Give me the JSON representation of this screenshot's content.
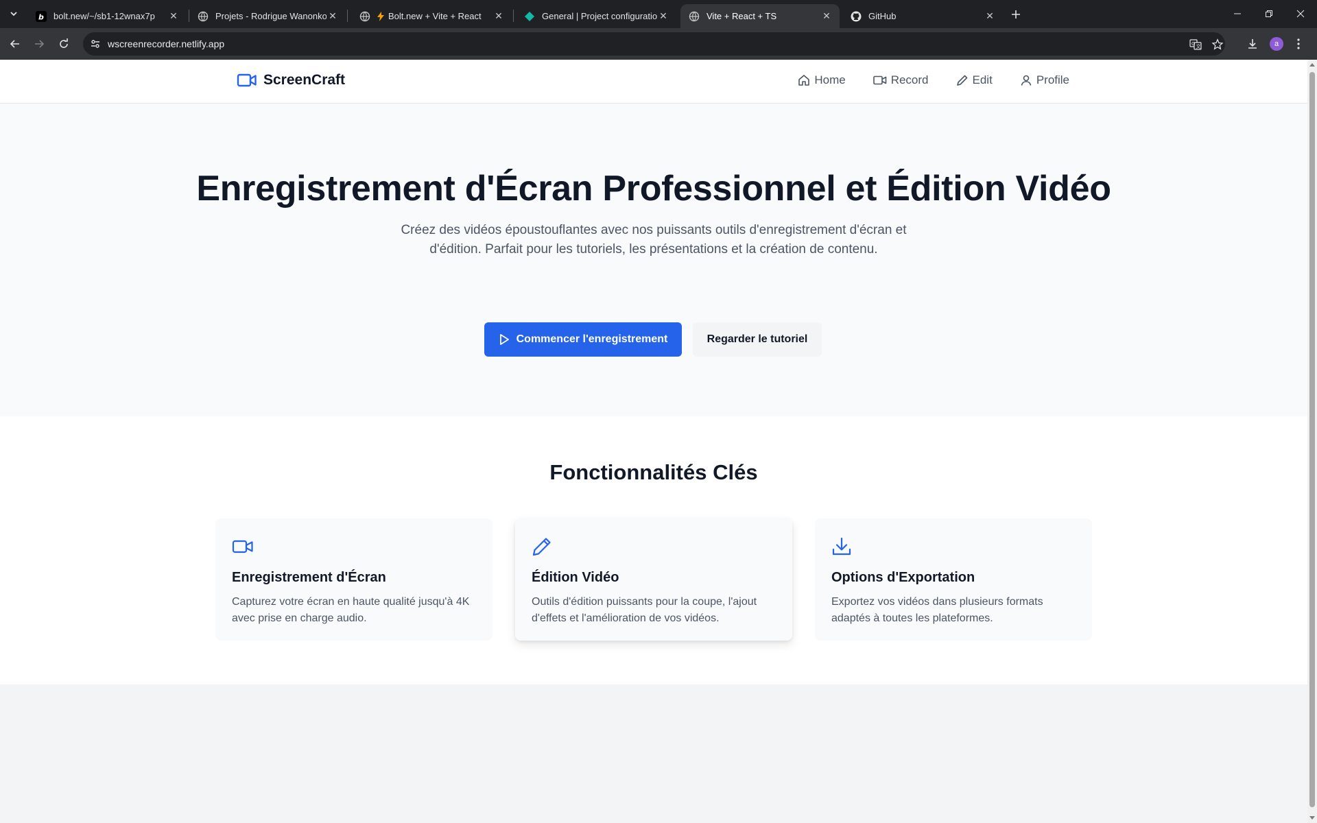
{
  "browser": {
    "tabs": [
      {
        "title": "bolt.new/~/sb1-12wnax7p",
        "icon": "bolt-b-icon"
      },
      {
        "title": "Projets - Rodrigue Wanonkou",
        "icon": "globe-icon"
      },
      {
        "title": "Bolt.new + Vite + React",
        "icon": "globe-icon"
      },
      {
        "title": "General | Project configuration |",
        "icon": "teal-diamond-icon"
      },
      {
        "title": "Vite + React + TS",
        "icon": "globe-icon",
        "active": true
      },
      {
        "title": "GitHub",
        "icon": "github-icon"
      }
    ],
    "url": "wscreenrecorder.netlify.app",
    "profile_initial": "a"
  },
  "app": {
    "brand": "ScreenCraft",
    "nav": {
      "home": "Home",
      "record": "Record",
      "edit": "Edit",
      "profile": "Profile"
    },
    "hero": {
      "title": "Enregistrement d'Écran Professionnel et Édition Vidéo",
      "subtitle": "Créez des vidéos époustouflantes avec nos puissants outils d'enregistrement d'écran et d'édition. Parfait pour les tutoriels, les présentations et la création de contenu.",
      "primary_cta": "Commencer l'enregistrement",
      "secondary_cta": "Regarder le tutoriel"
    },
    "features": {
      "heading": "Fonctionnalités Clés",
      "cards": [
        {
          "icon": "video-camera-icon",
          "title": "Enregistrement d'Écran",
          "description": "Capturez votre écran en haute qualité jusqu'à 4K avec prise en charge audio."
        },
        {
          "icon": "pencil-icon",
          "title": "Édition Vidéo",
          "description": "Outils d'édition puissants pour la coupe, l'ajout d'effets et l'amélioration de vos vidéos."
        },
        {
          "icon": "download-icon",
          "title": "Options d'Exportation",
          "description": "Exportez vos vidéos dans plusieurs formats adaptés à toutes les plateformes."
        }
      ]
    }
  },
  "colors": {
    "accent": "#2563eb",
    "heading": "#111827",
    "body_text": "#4b5563",
    "hero_bg": "#f9fafb",
    "page_bg": "#f3f4f6"
  }
}
